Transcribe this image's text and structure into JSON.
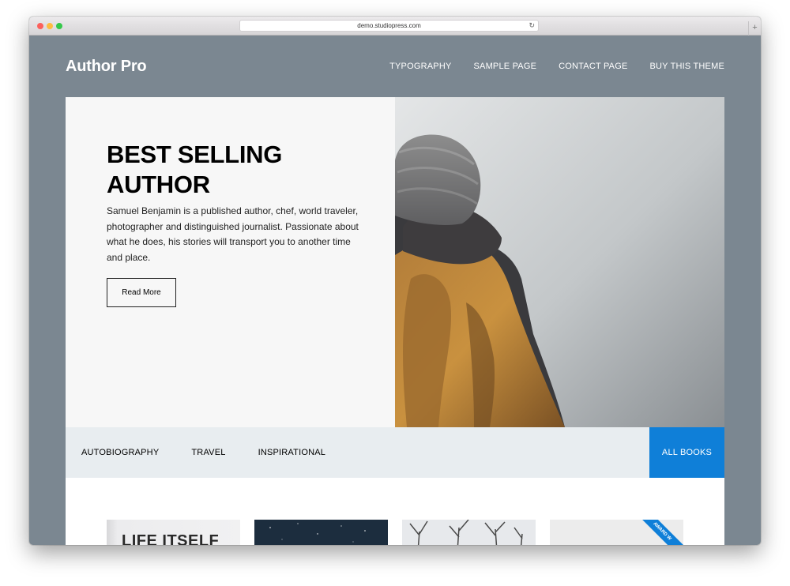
{
  "browser": {
    "url": "demo.studiopress.com",
    "reload_icon": "reload-icon",
    "new_tab_symbol": "+"
  },
  "header": {
    "site_title": "Author Pro",
    "nav": [
      "TYPOGRAPHY",
      "SAMPLE PAGE",
      "CONTACT PAGE",
      "BUY THIS THEME"
    ]
  },
  "hero": {
    "title": "BEST SELLING AUTHOR",
    "description": "Samuel Benjamin is a published author, chef, world traveler, photographer and distinguished journalist. Passionate about what he does, his stories will transport you to another time and place.",
    "button_label": "Read More"
  },
  "categories": {
    "items": [
      "AUTOBIOGRAPHY",
      "TRAVEL",
      "INSPIRATIONAL"
    ],
    "all_label": "ALL BOOKS"
  },
  "books": {
    "first_title": "LIFE ITSELF",
    "ribbon_text": "AWARD W"
  },
  "colors": {
    "page_background": "#7b8791",
    "accent": "#0f7fd8",
    "category_bar": "#e8edf0"
  }
}
